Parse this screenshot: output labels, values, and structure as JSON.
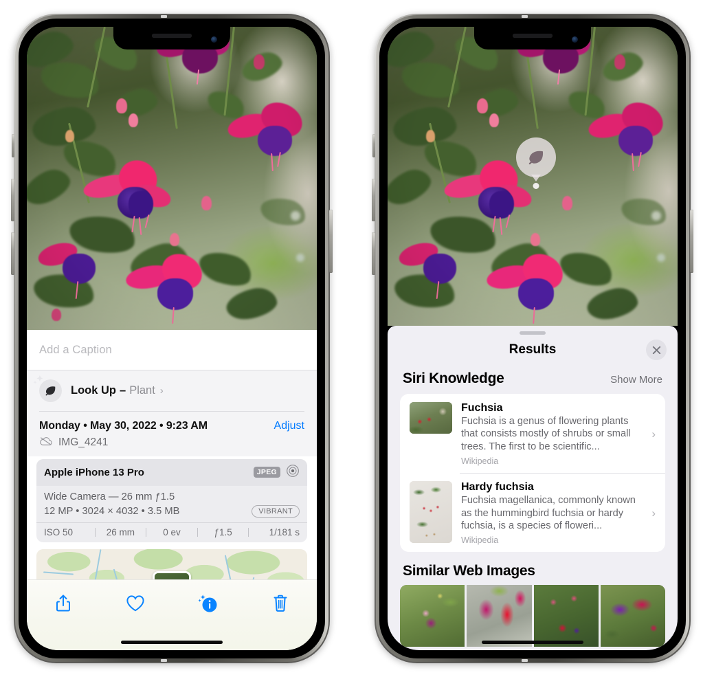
{
  "left_phone": {
    "name": "photos-info-screen",
    "caption_placeholder": "Add a Caption",
    "lookup": {
      "label_bold": "Look Up",
      "dash": "–",
      "label_sub": "Plant",
      "chevron": "›",
      "icon": "leaf-icon"
    },
    "date_line": "Monday • May 30, 2022 • 9:23 AM",
    "adjust_label": "Adjust",
    "file_name": "IMG_4241",
    "cloud_icon": "icloud-slash-icon",
    "exif": {
      "device": "Apple iPhone 13 Pro",
      "format_badge": "JPEG",
      "lens_icon": "aperture-icon",
      "line1": "Wide Camera — 26 mm ƒ1.5",
      "line2": "12 MP • 3024 × 4032 • 3.5 MB",
      "style_badge": "VIBRANT",
      "stats": [
        "ISO 50",
        "26 mm",
        "0 ev",
        "ƒ1.5",
        "1/181 s"
      ]
    },
    "toolbar": [
      {
        "name": "share-button",
        "icon": "share-icon"
      },
      {
        "name": "favorite-button",
        "icon": "heart-icon"
      },
      {
        "name": "info-button",
        "icon": "info-sparkle-icon"
      },
      {
        "name": "delete-button",
        "icon": "trash-icon"
      }
    ]
  },
  "right_phone": {
    "name": "visual-lookup-results-screen",
    "lens_badge_icon": "leaf-icon",
    "sheet": {
      "title": "Results",
      "close_icon": "close-icon",
      "grabber": "drag-handle"
    },
    "siri_knowledge": {
      "section_title": "Siri Knowledge",
      "show_more": "Show More",
      "results": [
        {
          "title": "Fuchsia",
          "description": "Fuchsia is a genus of flowering plants that consists mostly of shrubs or small trees. The first to be scientific...",
          "source": "Wikipedia",
          "thumb": "red-fuchsia-flowers-thumbnail",
          "chevron": "›"
        },
        {
          "title": "Hardy fuchsia",
          "description": "Fuchsia magellanica, commonly known as the hummingbird fuchsia or hardy fuchsia, is a species of floweri...",
          "source": "Wikipedia",
          "thumb": "hardy-fuchsia-branch-thumbnail",
          "chevron": "›"
        }
      ]
    },
    "similar_web_images": {
      "section_title": "Similar Web Images",
      "tiles": [
        "magenta-fuchsia-leaves-thumbnail",
        "red-purple-fuchsia-closeup-thumbnail",
        "fuchsia-bush-thumbnail",
        "purple-pink-fuchsia-thumbnail"
      ]
    }
  },
  "colors": {
    "accent_blue": "#007aff",
    "sheet_bg": "#f0eff4",
    "card_bg": "#ffffff",
    "secondary_text": "#6e6e73",
    "badge_gray": "#9a9aa0"
  }
}
